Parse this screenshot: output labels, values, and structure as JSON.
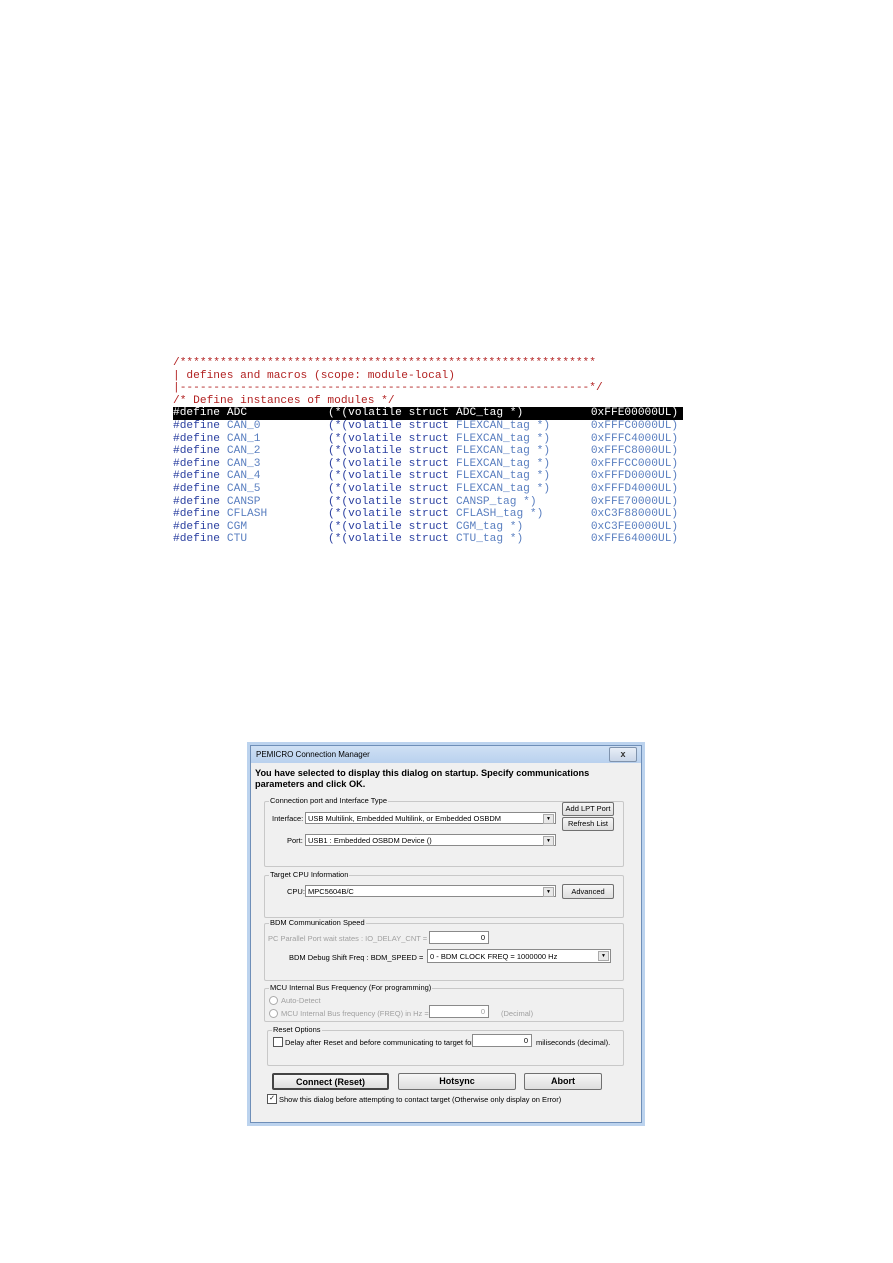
{
  "code_listing": {
    "lines": [
      {
        "text": "/**************************************************************",
        "kind": "comment"
      },
      {
        "text": "| defines and macros (scope: module-local)",
        "kind": "comment"
      },
      {
        "text": "|-------------------------------------------------------------*/",
        "kind": "comment"
      },
      {
        "text": "/* Define instances of modules */",
        "kind": "comment"
      }
    ],
    "defines": [
      {
        "kw": "#define",
        "name": "ADC",
        "cast_kw": "(*(volatile struct",
        "tag": "ADC_tag *)",
        "addr": "0xFFE00000UL)",
        "highlighted": true
      },
      {
        "kw": "#define",
        "name": "CAN_0",
        "cast_kw": "(*(volatile struct",
        "tag": "FLEXCAN_tag *)",
        "addr": "0xFFFC0000UL)"
      },
      {
        "kw": "#define",
        "name": "CAN_1",
        "cast_kw": "(*(volatile struct",
        "tag": "FLEXCAN_tag *)",
        "addr": "0xFFFC4000UL)"
      },
      {
        "kw": "#define",
        "name": "CAN_2",
        "cast_kw": "(*(volatile struct",
        "tag": "FLEXCAN_tag *)",
        "addr": "0xFFFC8000UL)"
      },
      {
        "kw": "#define",
        "name": "CAN_3",
        "cast_kw": "(*(volatile struct",
        "tag": "FLEXCAN_tag *)",
        "addr": "0xFFFCC000UL)"
      },
      {
        "kw": "#define",
        "name": "CAN_4",
        "cast_kw": "(*(volatile struct",
        "tag": "FLEXCAN_tag *)",
        "addr": "0xFFFD0000UL)"
      },
      {
        "kw": "#define",
        "name": "CAN_5",
        "cast_kw": "(*(volatile struct",
        "tag": "FLEXCAN_tag *)",
        "addr": "0xFFFD4000UL)"
      },
      {
        "kw": "#define",
        "name": "CANSP",
        "cast_kw": "(*(volatile struct",
        "tag": "CANSP_tag *)",
        "addr": "0xFFE70000UL)"
      },
      {
        "kw": "#define",
        "name": "CFLASH",
        "cast_kw": "(*(volatile struct",
        "tag": "CFLASH_tag *)",
        "addr": "0xC3F88000UL)"
      },
      {
        "kw": "#define",
        "name": "CGM",
        "cast_kw": "(*(volatile struct",
        "tag": "CGM_tag *)",
        "addr": "0xC3FE0000UL)"
      },
      {
        "kw": "#define",
        "name": "CTU",
        "cast_kw": "(*(volatile struct",
        "tag": "CTU_tag *)",
        "addr": "0xFFE64000UL)"
      }
    ]
  },
  "dialog": {
    "title": "PEMICRO Connection Manager",
    "close_glyph": "x",
    "heading": "You have selected to display this dialog on startup. Specify communications parameters and click OK.",
    "connection_group": {
      "legend": "Connection port and Interface Type",
      "interface_label": "Interface:",
      "interface_value": "USB Multilink, Embedded Multilink, or Embedded OSBDM",
      "port_label": "Port:",
      "port_value": "USB1 : Embedded OSBDM Device ()",
      "add_lpt_label": "Add LPT Port",
      "refresh_label": "Refresh List"
    },
    "cpu_group": {
      "legend": "Target CPU Information",
      "cpu_label": "CPU:",
      "cpu_value": "MPC5604B/C",
      "advanced_label": "Advanced"
    },
    "bdm_group": {
      "legend": "BDM Communication Speed",
      "delay_label": "PC Parallel Port wait states : IO_DELAY_CNT =",
      "delay_value": "0",
      "speed_label": "BDM Debug Shift Freq : BDM_SPEED =",
      "speed_value": "0  -  BDM CLOCK FREQ  =  1000000 Hz"
    },
    "mcu_group": {
      "legend": "MCU Internal Bus Frequency (For programming)",
      "auto_label": "Auto-Detect",
      "auto_selected": true,
      "manual_label": "MCU Internal Bus frequency (FREQ) in Hz =",
      "manual_value": "0",
      "decimal_label": "(Decimal)"
    },
    "reset_group": {
      "legend": "Reset Options",
      "delay_label": "Delay after Reset and before communicating to target for",
      "delay_checked": false,
      "delay_value": "0",
      "units_label": "miliseconds (decimal)."
    },
    "buttons": {
      "connect": "Connect (Reset)",
      "hotsync": "Hotsync",
      "abort": "Abort"
    },
    "show_dialog_label": "Show this dialog before attempting to contact target (Otherwise only display on Error)",
    "show_dialog_checked": true
  }
}
